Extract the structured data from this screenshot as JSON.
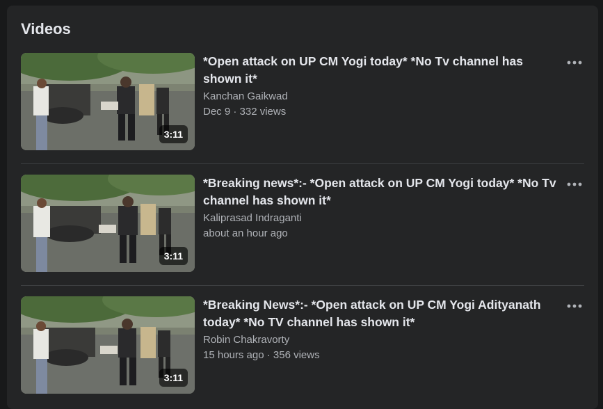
{
  "section": {
    "title": "Videos"
  },
  "videos": [
    {
      "title": "*Open attack on UP CM Yogi today* *No Tv channel has shown it*",
      "channel": "Kanchan Gaikwad",
      "meta": "Dec 9 · 332 views",
      "duration": "3:11",
      "more_icon": "more-horizontal-icon"
    },
    {
      "title": "*Breaking news*:- *Open attack on UP CM Yogi today* *No Tv channel has shown it*",
      "channel": "Kaliprasad Indraganti",
      "meta": "about an hour ago",
      "duration": "3:11",
      "more_icon": "more-horizontal-icon"
    },
    {
      "title": "*Breaking News*:- *Open attack on UP CM Yogi Adityanath today* *No TV channel has shown it*",
      "channel": "Robin Chakravorty",
      "meta": "15 hours ago · 356 views",
      "duration": "3:11",
      "more_icon": "more-horizontal-icon"
    }
  ],
  "colors": {
    "page_bg": "#18191a",
    "panel_bg": "#242526",
    "primary_text": "#e4e6eb",
    "secondary_text": "#b0b3b8",
    "divider": "#3e4042"
  }
}
